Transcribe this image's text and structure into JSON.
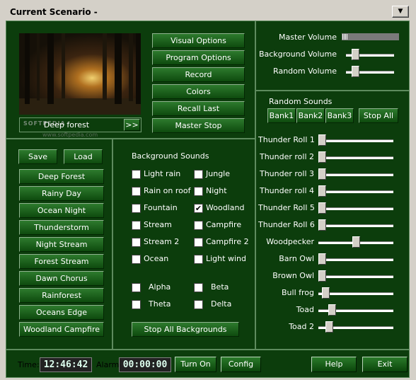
{
  "window": {
    "title": "Current Scenario -",
    "menu_arrow": "▼"
  },
  "scene": {
    "name": "Deep forest",
    "next_label": ">>",
    "watermark": "SOFTPEDIA",
    "watermark_url": "www.softpedia.com"
  },
  "options": [
    "Visual Options",
    "Program Options",
    "Record",
    "Colors",
    "Recall Last",
    "Master Stop"
  ],
  "preset_buttons": {
    "save": "Save",
    "load": "Load"
  },
  "presets": [
    "Deep Forest",
    "Rainy Day",
    "Ocean Night",
    "Thunderstorm",
    "Night Stream",
    "Forest Stream",
    "Dawn Chorus",
    "Rainforest",
    "Oceans Edge",
    "Woodland Campfire"
  ],
  "background": {
    "title": "Background Sounds",
    "col1": [
      {
        "label": "Light rain",
        "checked": false
      },
      {
        "label": "Rain on roof",
        "checked": false
      },
      {
        "label": "Fountain",
        "checked": false
      },
      {
        "label": "Stream",
        "checked": false
      },
      {
        "label": "Stream 2",
        "checked": false
      },
      {
        "label": "Ocean",
        "checked": false
      }
    ],
    "col2": [
      {
        "label": "Jungle",
        "checked": false
      },
      {
        "label": "Night",
        "checked": false
      },
      {
        "label": "Woodland",
        "checked": true
      },
      {
        "label": "Campfire",
        "checked": false
      },
      {
        "label": "Campfire 2",
        "checked": false
      },
      {
        "label": "Light wind",
        "checked": false
      }
    ],
    "waves1": [
      {
        "label": "Alpha",
        "checked": false
      },
      {
        "label": "Theta",
        "checked": false
      }
    ],
    "waves2": [
      {
        "label": "Beta",
        "checked": false
      },
      {
        "label": "Delta",
        "checked": false
      }
    ],
    "stop_all": "Stop All Backgrounds"
  },
  "volumes": [
    {
      "label": "Master Volume",
      "level": 0.0
    },
    {
      "label": "Background Volume",
      "level": 0.2
    },
    {
      "label": "Random Volume",
      "level": 0.2
    }
  ],
  "random": {
    "title": "Random Sounds",
    "banks": [
      "Bank1",
      "Bank2",
      "Bank3"
    ],
    "stop_all": "Stop All",
    "sounds": [
      {
        "label": "Thunder Roll 1",
        "level": 0.0
      },
      {
        "label": "Thunder roll 2",
        "level": 0.0
      },
      {
        "label": "Thunder roll 3",
        "level": 0.0
      },
      {
        "label": "Thunder roll 4",
        "level": 0.0
      },
      {
        "label": "Thunder Roll 5",
        "level": 0.0
      },
      {
        "label": "Thunder Roll 6",
        "level": 0.0
      },
      {
        "label": "Woodpecker",
        "level": 0.5
      },
      {
        "label": "Barn Owl",
        "level": 0.0
      },
      {
        "label": "Brown Owl",
        "level": 0.0
      },
      {
        "label": "Bull frog",
        "level": 0.05
      },
      {
        "label": "Toad",
        "level": 0.15
      },
      {
        "label": "Toad 2",
        "level": 0.1
      }
    ]
  },
  "footer": {
    "time_label": "Time:",
    "time": "12:46:42",
    "alarm_label": "Alarm:",
    "alarm": "00:00:00",
    "turn_on": "Turn On",
    "config": "Config",
    "help": "Help",
    "exit": "Exit"
  },
  "colors": {
    "panel": "#0c3d0c",
    "button": "#1f6b1f"
  }
}
